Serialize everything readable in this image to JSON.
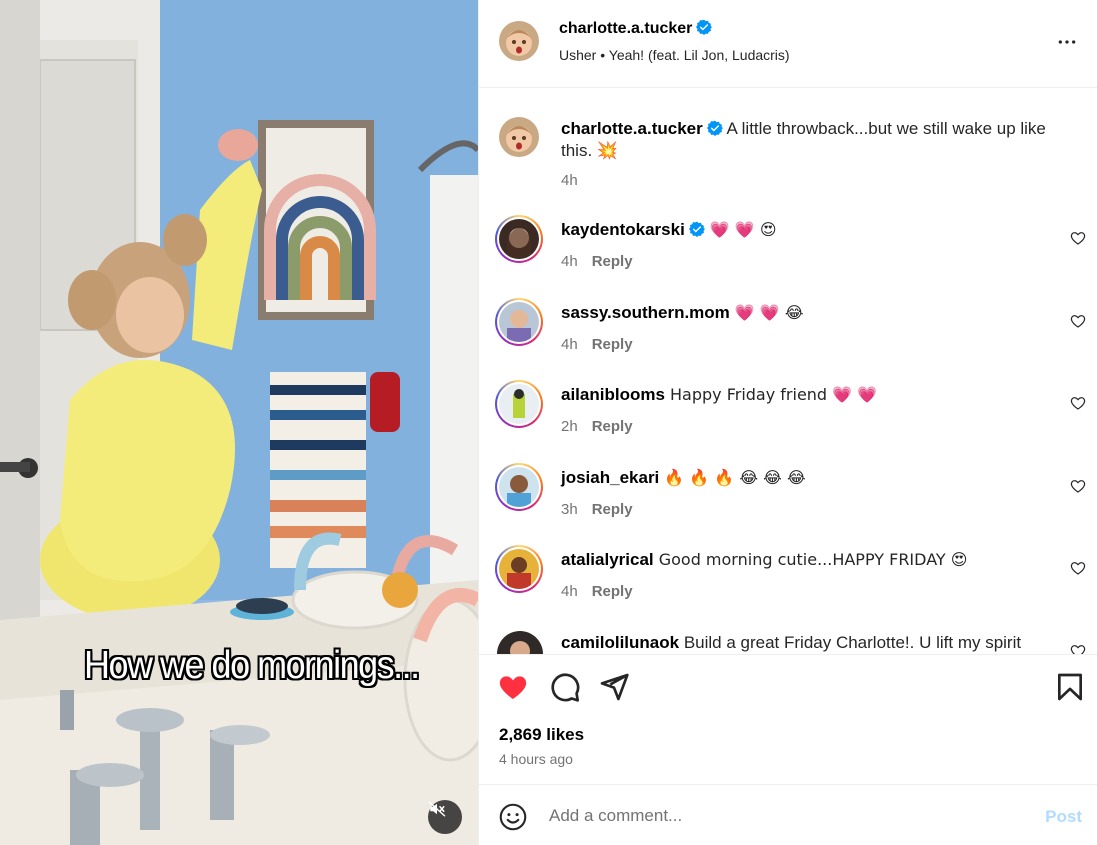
{
  "video": {
    "caption_overlay": "How we do mornings...",
    "mute_icon": "volume-muted-icon"
  },
  "header": {
    "username": "charlotte.a.tucker",
    "verified": true,
    "audio": "Usher • Yeah! (feat. Lil Jon, Ludacris)",
    "more_icon": "more-options-icon"
  },
  "caption": {
    "username": "charlotte.a.tucker",
    "text": " A little throwback...but we still wake up like this. 💥",
    "time": "4h"
  },
  "comments": [
    {
      "username": "kaydentokarski",
      "verified": true,
      "text": " 💗 💗 😍",
      "time": "4h",
      "reply": "Reply"
    },
    {
      "username": "sassy.southern.mom",
      "verified": false,
      "text": " 💗 💗 😂",
      "time": "4h",
      "reply": "Reply"
    },
    {
      "username": "ailaniblooms",
      "verified": false,
      "text": " Happy Friday friend 💗 💗",
      "time": "2h",
      "reply": "Reply"
    },
    {
      "username": "josiah_ekari",
      "verified": false,
      "text": " 🔥 🔥 🔥 😂 😂 😂",
      "time": "3h",
      "reply": "Reply"
    },
    {
      "username": "atalialyrical",
      "verified": false,
      "text": " Good morning cutie...HAPPY FRIDAY 😍",
      "time": "4h",
      "reply": "Reply"
    },
    {
      "username": "camilolilunaok",
      "verified": false,
      "text": " Build a great Friday Charlotte!. U lift my spirit",
      "time": "",
      "reply": ""
    }
  ],
  "actions": {
    "like_icon": "heart-filled-icon",
    "comment_icon": "comment-icon",
    "share_icon": "share-icon",
    "save_icon": "bookmark-icon",
    "likes": "2,869 likes",
    "posted": "4 hours ago"
  },
  "add_comment": {
    "placeholder": "Add a comment...",
    "post_label": "Post",
    "emoji_icon": "emoji-icon"
  },
  "colors": {
    "like_red": "#ff3040",
    "verified_blue": "#0095f6",
    "post_disabled": "#b3dbff",
    "meta_gray": "#737373"
  }
}
